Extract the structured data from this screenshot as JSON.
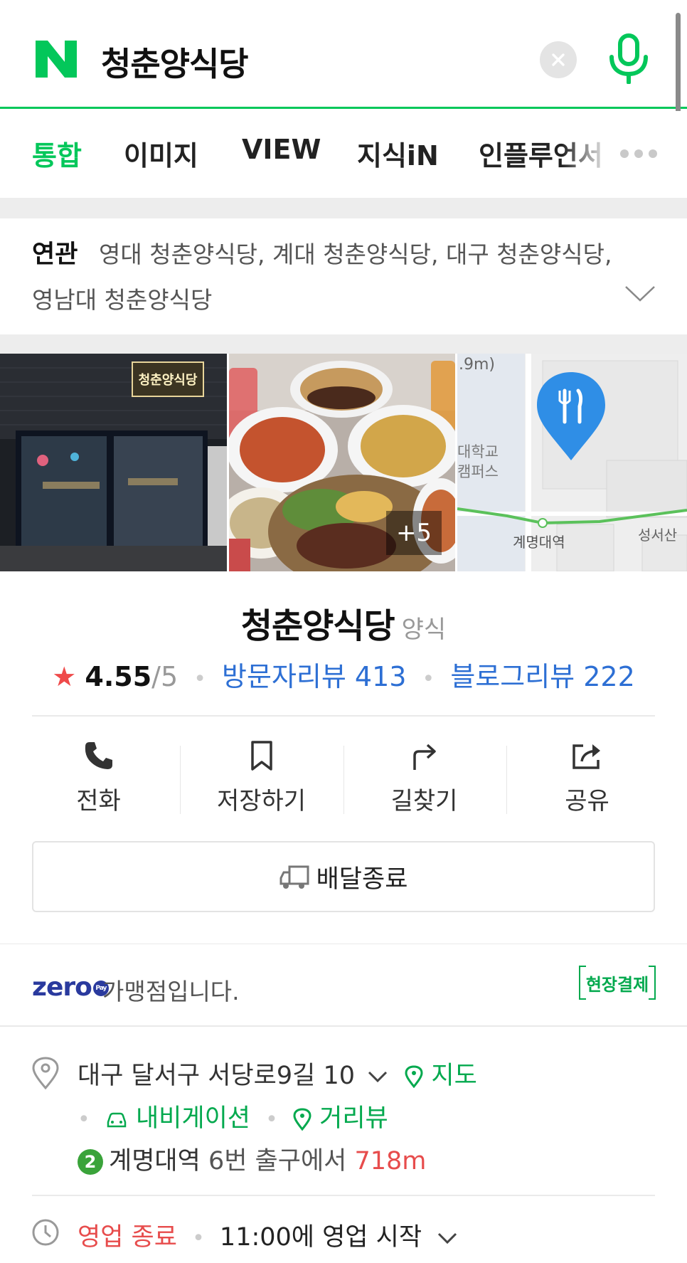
{
  "search": {
    "query": "청춘양식당",
    "logo_letter": "N",
    "clear_icon": "close-icon",
    "mic_icon": "microphone-icon"
  },
  "tabs": [
    {
      "label": "통합",
      "active": true
    },
    {
      "label": "이미지",
      "active": false
    },
    {
      "label": "VIEW",
      "active": false
    },
    {
      "label": "지식iN",
      "active": false
    },
    {
      "label": "인플루언서",
      "active": false
    }
  ],
  "related": {
    "label": "연관",
    "line1": "영대 청춘양식당, 계대 청춘양식당, 대구 청춘양식당,",
    "line2": "영남대 청춘양식당"
  },
  "photos": {
    "sign_text": "청춘양식당",
    "more_count": "+5",
    "map_labels": {
      "distance": ".9m)",
      "campus": "대학교 캠퍼스",
      "station1": "계명대역",
      "station2": "성서산"
    }
  },
  "place": {
    "name": "청춘양식당",
    "category": "양식",
    "rating": "4.55",
    "rating_max": "/5",
    "visitor_reviews": "방문자리뷰 413",
    "blog_reviews": "블로그리뷰 222"
  },
  "actions": [
    {
      "label": "전화",
      "icon": "phone-icon"
    },
    {
      "label": "저장하기",
      "icon": "bookmark-icon"
    },
    {
      "label": "길찾기",
      "icon": "directions-icon"
    },
    {
      "label": "공유",
      "icon": "share-icon"
    }
  ],
  "delivery": {
    "label": "배달종료",
    "icon": "delivery-truck-icon"
  },
  "zeropay": {
    "logo": "zero",
    "pay": "Pay",
    "text": "가맹점입니다.",
    "onsite": "현장결제"
  },
  "address": {
    "text": "대구 달서구 서당로9길 10",
    "map_link": "지도",
    "navigation": "내비게이션",
    "street_view": "거리뷰",
    "subway_line": "2",
    "station": "계명대역",
    "exit_text": "6번 출구에서",
    "distance": "718m"
  },
  "hours": {
    "status": "영업 종료",
    "next_open": "11:00에 영업 시작"
  },
  "colors": {
    "naver_green": "#03c75a",
    "link_blue": "#2d6fd4",
    "alert_red": "#e74c4c",
    "star_red": "#ef4a4a"
  }
}
